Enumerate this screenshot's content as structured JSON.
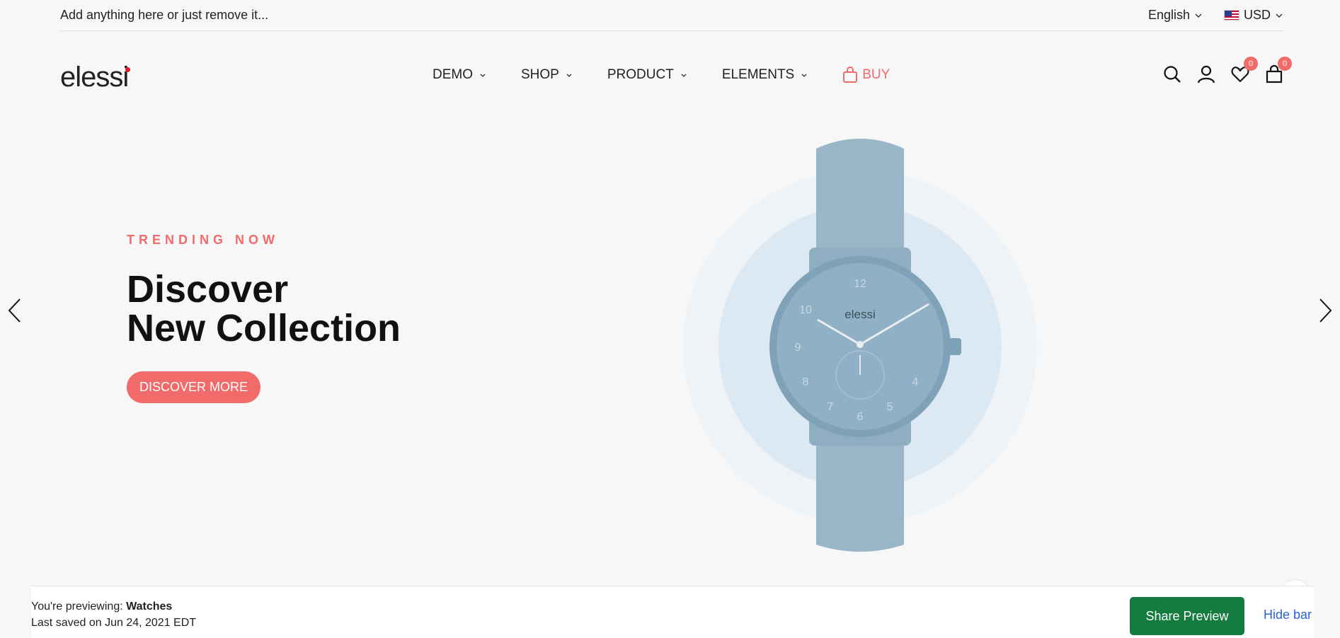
{
  "topbar": {
    "message": "Add anything here or just remove it...",
    "language": "English",
    "currency": "USD",
    "flag_icon": "us-flag-icon"
  },
  "header": {
    "logo_text": "elessi",
    "nav": [
      {
        "label": "DEMO"
      },
      {
        "label": "SHOP"
      },
      {
        "label": "PRODUCT"
      },
      {
        "label": "ELEMENTS"
      }
    ],
    "buy_label": "BUY",
    "wishlist_count": "0",
    "cart_count": "0",
    "accent_color": "#f26b6b"
  },
  "hero": {
    "subtitle": "TRENDING NOW",
    "title_line1": "Discover",
    "title_line2": "New Collection",
    "button_label": "DISCOVER MORE",
    "watch_brand": "elessi",
    "dial_numbers": [
      "12",
      "10",
      "9",
      "8",
      "7",
      "6",
      "5",
      "4"
    ]
  },
  "preview_bar": {
    "prefix": "You're previewing:",
    "theme_name": "Watches",
    "last_saved": "Last saved on Jun 24, 2021 EDT",
    "share_label": "Share Preview",
    "hide_label": "Hide bar",
    "share_color": "#157c3f",
    "hide_color": "#2b5fd9"
  }
}
